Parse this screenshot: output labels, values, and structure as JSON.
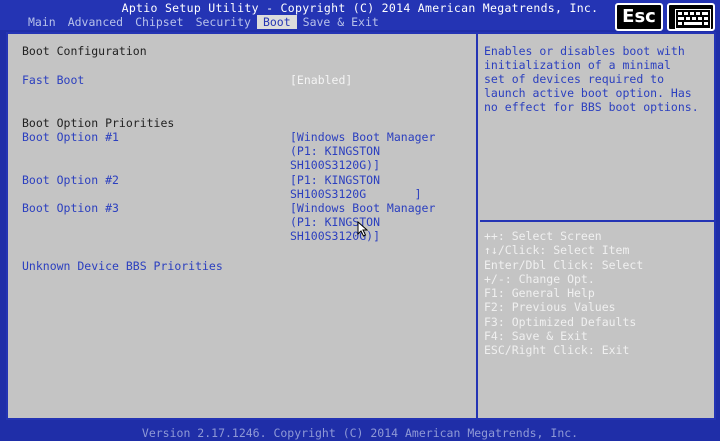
{
  "title": "Aptio Setup Utility - Copyright (C) 2014 American Megatrends, Inc.",
  "tabs": [
    "Main",
    "Advanced",
    "Chipset",
    "Security",
    "Boot",
    "Save & Exit"
  ],
  "active_tab": "Boot",
  "esc_label": "Esc",
  "settings": {
    "boot_configuration": "Boot Configuration",
    "fast_boot": {
      "label": "Fast Boot",
      "value": "[Enabled]"
    },
    "boot_option_priorities": "Boot Option Priorities",
    "boot_option_1": {
      "label": "Boot Option #1",
      "value_lines": [
        "[Windows Boot Manager",
        "(P1: KINGSTON",
        "SH100S3120G)]"
      ]
    },
    "boot_option_2": {
      "label": "Boot Option #2",
      "value_lines": [
        "[P1: KINGSTON",
        "SH100S3120G       ]"
      ]
    },
    "boot_option_3": {
      "label": "Boot Option #3",
      "value_lines": [
        "[Windows Boot Manager",
        "(P1: KINGSTON",
        "SH100S3120G)]"
      ]
    },
    "unknown_device": "Unknown Device BBS Priorities"
  },
  "help": {
    "description_lines": [
      "Enables or disables boot with",
      "initialization of a minimal",
      "set of devices required to",
      "launch active boot option. Has",
      "no effect for BBS boot options."
    ],
    "keys": [
      "++: Select Screen",
      "↑↓/Click: Select Item",
      "Enter/Dbl Click: Select",
      "+/-: Change Opt.",
      "F1: General Help",
      "F2: Previous Values",
      "F3: Optimized Defaults",
      "F4: Save & Exit",
      "ESC/Right Click: Exit"
    ]
  },
  "footer": "Version 2.17.1246. Copyright (C) 2014 American Megatrends, Inc.",
  "colors": {
    "bios_blue": "#2434b4",
    "panel_gray": "#c4c4c4",
    "label_blue": "#2b3fbf",
    "active_tab_bg": "#dcdcdc"
  }
}
